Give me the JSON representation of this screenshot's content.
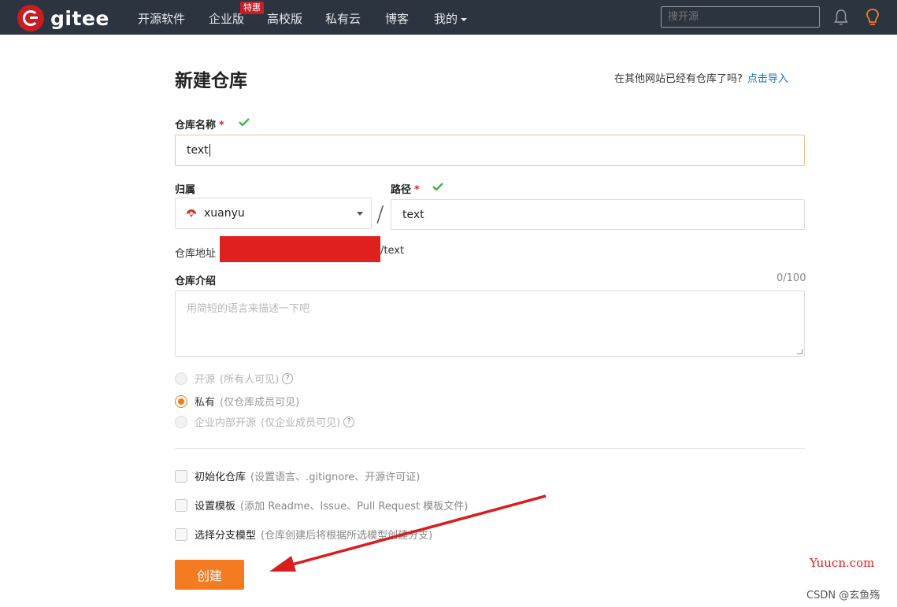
{
  "navbar": {
    "logo_text": "gitee",
    "items": [
      {
        "label": "开源软件"
      },
      {
        "label": "企业版"
      },
      {
        "label": "高校版"
      },
      {
        "label": "私有云"
      },
      {
        "label": "博客"
      },
      {
        "label": "我的"
      }
    ],
    "badge": "特惠",
    "search_placeholder": "搜开源",
    "accent": "#c71d23"
  },
  "page": {
    "title": "新建仓库",
    "import_hint": "在其他网站已经有仓库了吗?",
    "import_link": "点击导入"
  },
  "form": {
    "name_label": "仓库名称",
    "required_mark": "*",
    "name_value": "text",
    "owner_label": "归属",
    "owner_value": "xuanyu",
    "path_label": "路径",
    "path_value": "text",
    "slash": "/",
    "address_label": "仓库地址",
    "address_suffix": "/text",
    "intro_label": "仓库介绍",
    "intro_counter": "0/100",
    "intro_placeholder": "用简短的语言来描述一下吧",
    "visibility": [
      {
        "label": "开源",
        "note": "(所有人可见)",
        "help": "?",
        "state": "disabled"
      },
      {
        "label": "私有",
        "note": "(仅仓库成员可见)",
        "state": "checked"
      },
      {
        "label": "企业内部开源",
        "note": "(仅企业成员可见)",
        "help": "?",
        "state": "disabled"
      }
    ],
    "options": [
      {
        "label": "初始化仓库",
        "note": "(设置语言、.gitignore、开源许可证)",
        "checked": false
      },
      {
        "label": "设置模板",
        "note": "(添加 Readme、Issue、Pull Request 模板文件)",
        "checked": false
      },
      {
        "label": "选择分支模型",
        "note": "(仓库创建后将根据所选模型创建分支)",
        "checked": false
      }
    ],
    "submit_label": "创建",
    "accent": "#f47b20"
  },
  "watermarks": {
    "yuucn": "Yuucn.com",
    "csdn": "CSDN @玄鱼殇"
  }
}
